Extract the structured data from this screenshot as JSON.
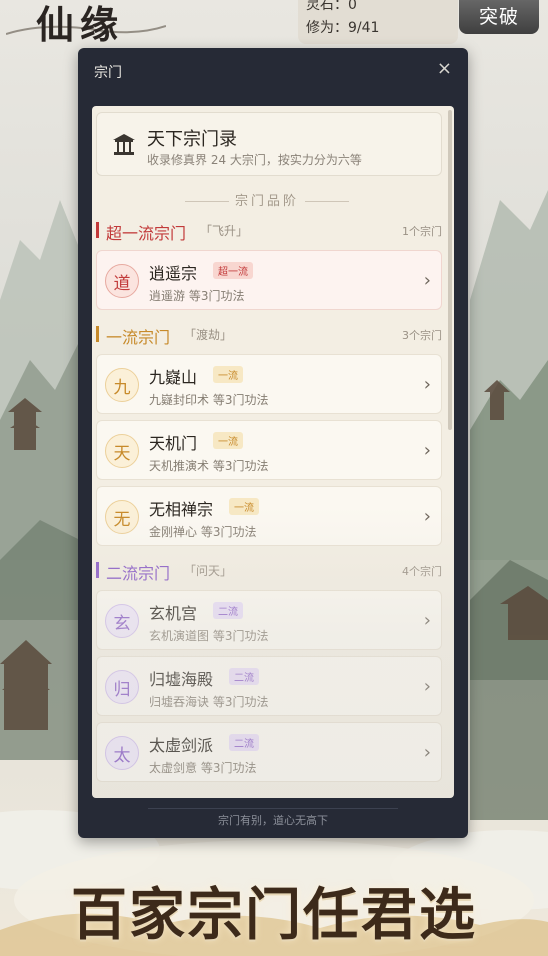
{
  "app": {
    "logo": "仙缘"
  },
  "topbar": {
    "stone_label": "灵石：0",
    "cultivation_label": "修为：9/41",
    "breakthrough_label": "突破"
  },
  "modal": {
    "title": "宗门",
    "close_icon": "×",
    "footer": "宗门有别，道心无高下"
  },
  "header": {
    "title": "天下宗门录",
    "subtitle": "收录修真界 24 大宗门，按实力分为六等",
    "icon": "temple-icon"
  },
  "rank_divider": "宗门品阶",
  "sections": [
    {
      "name": "超一流宗门",
      "tag": "「飞升」",
      "count": "1个宗门",
      "color": "#c23a3a",
      "sects": [
        {
          "seal": "道",
          "name": "逍遥宗",
          "badge": "超一流",
          "desc": "逍遥游 等3门功法"
        }
      ]
    },
    {
      "name": "一流宗门",
      "tag": "「渡劫」",
      "count": "3个宗门",
      "color": "#c78a2a",
      "sects": [
        {
          "seal": "九",
          "name": "九嶷山",
          "badge": "一流",
          "desc": "九嶷封印术 等3门功法"
        },
        {
          "seal": "天",
          "name": "天机门",
          "badge": "一流",
          "desc": "天机推演术 等3门功法"
        },
        {
          "seal": "无",
          "name": "无相禅宗",
          "badge": "一流",
          "desc": "金刚禅心 等3门功法"
        }
      ]
    },
    {
      "name": "二流宗门",
      "tag": "「问天」",
      "count": "4个宗门",
      "color": "#8a5cc7",
      "sects": [
        {
          "seal": "玄",
          "name": "玄机宫",
          "badge": "二流",
          "desc": "玄机演道图 等3门功法"
        },
        {
          "seal": "归",
          "name": "归墟海殿",
          "badge": "二流",
          "desc": "归墟吞海诀 等3门功法"
        },
        {
          "seal": "太",
          "name": "太虚剑派",
          "badge": "二流",
          "desc": "太虚剑意 等3门功法"
        }
      ]
    }
  ],
  "banner": "百家宗门任君选"
}
